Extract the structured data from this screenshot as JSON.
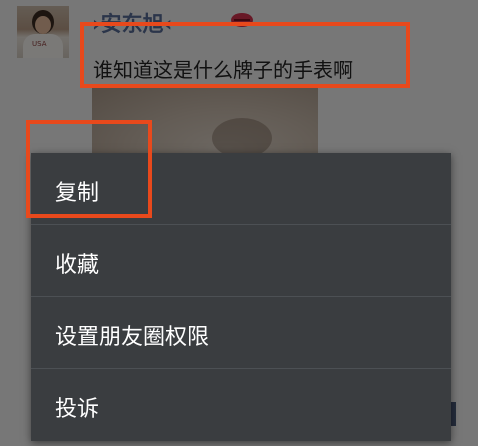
{
  "post": {
    "username": "›安东旭‹",
    "text": "谁知道这是什么牌子的手表啊",
    "avatar_shirt_text": "USA"
  },
  "context_menu": {
    "items": [
      {
        "label": "复制"
      },
      {
        "label": "收藏"
      },
      {
        "label": "设置朋友圈权限"
      },
      {
        "label": "投诉"
      }
    ]
  },
  "colors": {
    "overlay": "#7f7f7f",
    "menu_background": "#3a3d40",
    "menu_divider": "#4c5054",
    "highlight_border": "#e8491c",
    "username": "#576b95"
  },
  "icons": {
    "emoji": "lips-icon"
  }
}
